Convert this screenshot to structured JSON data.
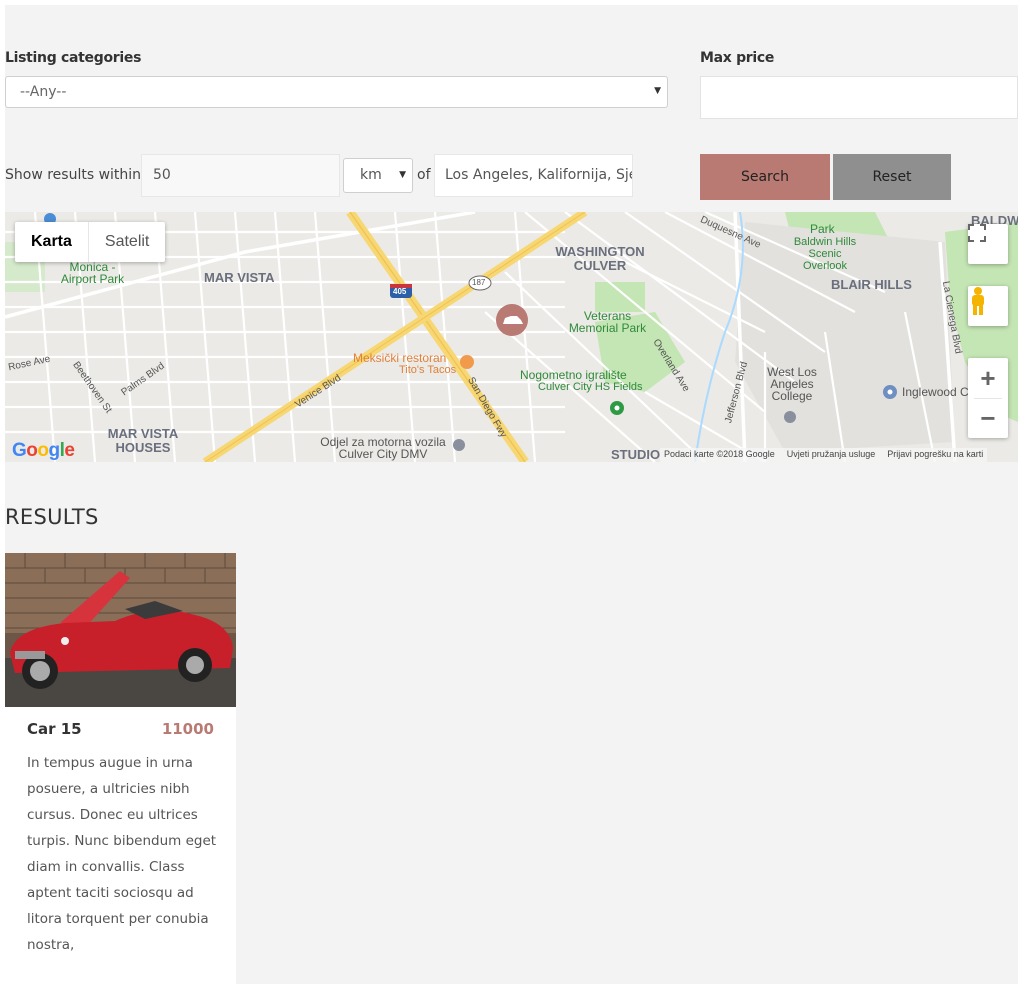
{
  "filters": {
    "category_label": "Listing categories",
    "category_value": "--Any--",
    "max_price_label": "Max price",
    "max_price_value": "",
    "within_label": "Show results within",
    "distance_value": "50",
    "unit_value": "km",
    "of_label": "of",
    "location_value": "Los Angeles, Kalifornija, Sjedinjene Američke Države",
    "search_label": "Search",
    "reset_label": "Reset"
  },
  "map": {
    "type_map": "Karta",
    "type_satellite": "Satelit",
    "labels": {
      "mar_vista": "MAR VISTA",
      "washington_culver": "WASHINGTON CULVER",
      "blair_hills": "BLAIR HILLS",
      "mar_vista_houses": "MAR VISTA HOUSES",
      "baldwin": "BALDWI",
      "studio": "STUDIO"
    },
    "green_labels": {
      "park": "Park",
      "baldwin_overlook": "Baldwin Hills Scenic Overlook",
      "veterans": "Veterans Memorial Park",
      "nogometno": "Nogometno igralište",
      "monica_airport": "Monica - Airport Park"
    },
    "poi_labels": {
      "culver_hs": "Culver City HS Fields",
      "west_la_college": "West Los Angeles College",
      "inglewood": "Inglewood C",
      "dmv": "Odjel za motorna vozila Culver City DMV",
      "meksicki": "Meksički restoran",
      "titos": "Tito's Tacos"
    },
    "road_labels": {
      "venice": "Venice Blvd",
      "sandiego": "San Diego Fwy",
      "duquesne": "Duquesne Ave",
      "overland": "Overland Ave",
      "jefferson": "Jefferson Blvd",
      "lacienega": "La Cienega Blvd",
      "palms": "Palms Blvd",
      "beethoven": "Beethoven St",
      "rose": "Rose Ave",
      "shield_405": "405",
      "shield_187": "187"
    },
    "google_logo": "Google",
    "attribution_data": "Podaci karte ©2018 Google",
    "attribution_terms": "Uvjeti pružanja usluge",
    "attribution_report": "Prijavi pogrešku na karti"
  },
  "results": {
    "title": "RESULTS",
    "items": [
      {
        "title": "Car 15",
        "price": "11000",
        "description": "In tempus augue in urna posuere, a ultricies nibh cursus. Donec eu ultrices turpis. Nunc bibendum eget diam in convallis. Class aptent taciti sociosqu ad litora torquent per conubia nostra,"
      }
    ]
  },
  "colors": {
    "accent": "#b87a72",
    "reset": "#8f8f8f",
    "page_bg": "#f3f3f3"
  }
}
